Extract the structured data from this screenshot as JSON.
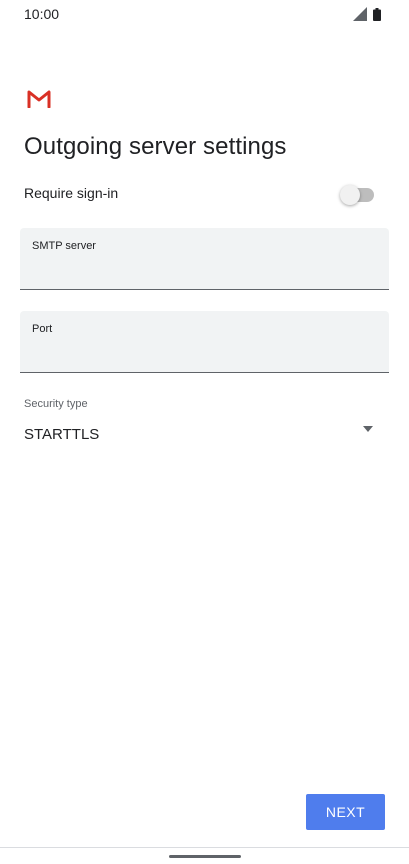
{
  "status_bar": {
    "time": "10:00",
    "icons": [
      "signal-icon",
      "battery-icon"
    ]
  },
  "app": {
    "logo_icon": "gmail-icon",
    "logo_color": "#d93025"
  },
  "page": {
    "title": "Outgoing server settings"
  },
  "require_signin": {
    "label": "Require sign-in",
    "enabled": false
  },
  "smtp_server": {
    "label": "SMTP server",
    "value": ""
  },
  "port": {
    "label": "Port",
    "value": ""
  },
  "security_type": {
    "label": "Security type",
    "value": "STARTTLS",
    "icon": "dropdown-arrow-icon"
  },
  "actions": {
    "next_label": "NEXT",
    "accent_color": "#4f7ded"
  }
}
